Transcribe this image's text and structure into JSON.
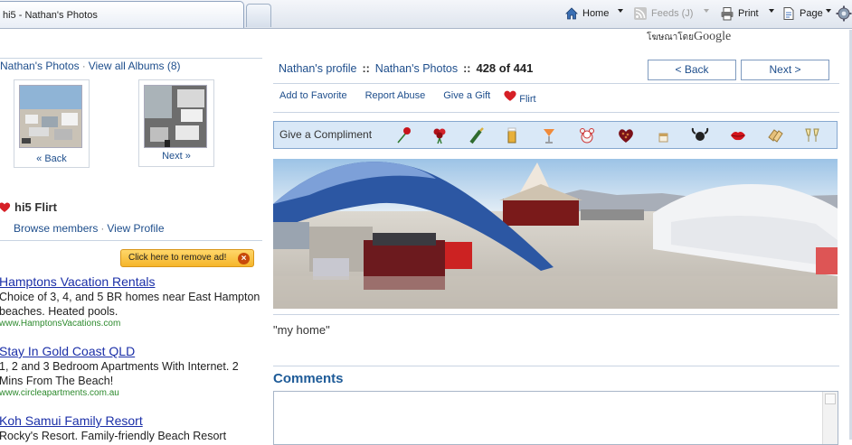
{
  "browser": {
    "tab_title": "hi5 - Nathan's Photos",
    "commands": {
      "home": "Home",
      "feeds": "Feeds (J)",
      "print": "Print",
      "page": "Page"
    }
  },
  "left": {
    "crumb_profile": "Nathan's Photos",
    "crumb_albums": "View all Albums (8)",
    "thumb_back_label": "« Back",
    "thumb_next_label": "Next »",
    "flirt_title": "hi5 Flirt",
    "browse_members": "Browse members",
    "view_profile": "View Profile",
    "remove_ad": "Click here to remove ad!",
    "ads": [
      {
        "title": "Hamptons Vacation Rentals",
        "body": "Choice of 3, 4, and 5 BR homes near East Hampton beaches. Heated pools.",
        "url": "www.HamptonsVacations.com"
      },
      {
        "title": "Stay In Gold Coast QLD",
        "body": "1, 2 and 3 Bedroom Apartments With Internet. 2 Mins From The Beach!",
        "url": "www.circleapartments.com.au"
      },
      {
        "title": "Koh Samui Family Resort",
        "body": "Rocky's Resort. Family-friendly Beach Resort",
        "url": ""
      }
    ]
  },
  "main": {
    "sponsor_prefix": "โฆษณาโดย",
    "sponsor_brand": "Google",
    "nav_profile": "Nathan's profile",
    "nav_photos": "Nathan's Photos",
    "separator": "::",
    "photo_count": "428 of 441",
    "back_button": "< Back",
    "next_button": "Next >",
    "actions": {
      "favorite": "Add to Favorite",
      "report": "Report Abuse",
      "gift": "Give a Gift",
      "flirt": "Flirt"
    },
    "compliment_label": "Give a Compliment",
    "compliment_icons": [
      "rose-icon",
      "bouquet-icon",
      "champagne-icon",
      "beer-icon",
      "cocktail-icon",
      "teddy-bear-icon",
      "chocolates-icon",
      "coffee-icon",
      "bull-icon",
      "lips-icon",
      "clapping-hands-icon",
      "toast-glasses-icon"
    ],
    "photo_caption": "\"my home\"",
    "comments_title": "Comments"
  },
  "colors": {
    "link": "#1e4e8c",
    "ad_title": "#1b2fa8",
    "ad_url": "#2d8a2d",
    "compliment_bg": "#d9e8f7",
    "comments_heading": "#1e5b98"
  }
}
